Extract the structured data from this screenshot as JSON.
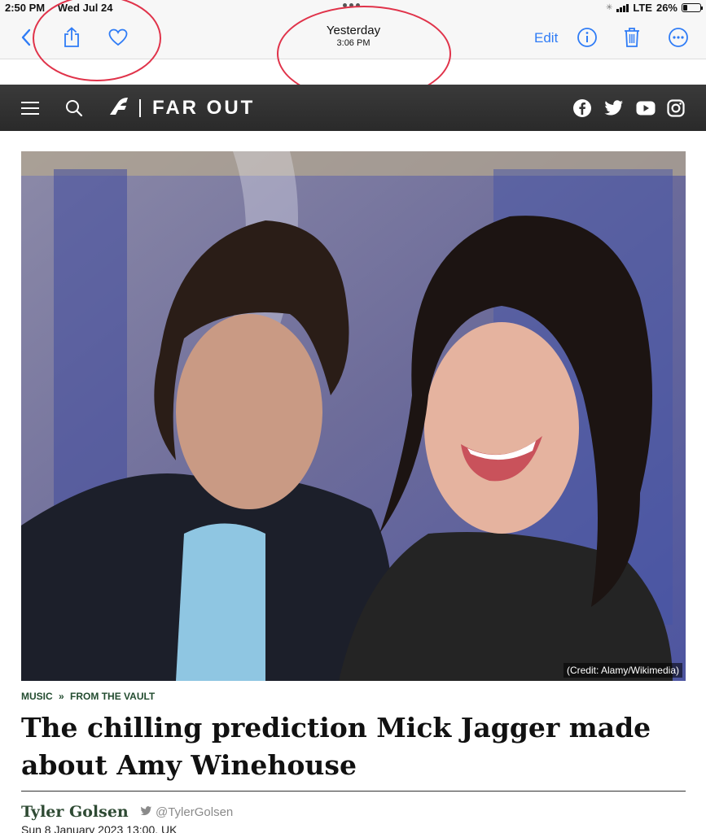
{
  "status_bar": {
    "time": "2:50 PM",
    "date": "Wed Jul 24",
    "network": "LTE",
    "battery": "26%",
    "battery_level": 0.26
  },
  "toolbar": {
    "title": "Yesterday",
    "subtitle": "3:06 PM",
    "edit_label": "Edit",
    "icons": [
      "back-chevron-icon",
      "share-icon",
      "heart-icon",
      "info-icon",
      "trash-icon",
      "more-icon"
    ]
  },
  "site": {
    "logo_text": "FAR OUT",
    "social": [
      "facebook-icon",
      "twitter-icon",
      "youtube-icon",
      "instagram-icon"
    ]
  },
  "article": {
    "image_credit": "(Credit: Alamy/Wikimedia)",
    "category": "MUSIC",
    "separator": "»",
    "subcategory": "FROM THE VAULT",
    "headline": "The chilling prediction Mick Jagger made about Amy Winehouse",
    "author": "Tyler Golsen",
    "twitter_handle": "@TylerGolsen",
    "date": "Sun 8 January 2023 13:00, UK"
  },
  "colors": {
    "ios_blue": "#2f7cf6",
    "annotation_red": "#e0334a",
    "header_bg": "#333333",
    "category_green": "#234c30"
  }
}
